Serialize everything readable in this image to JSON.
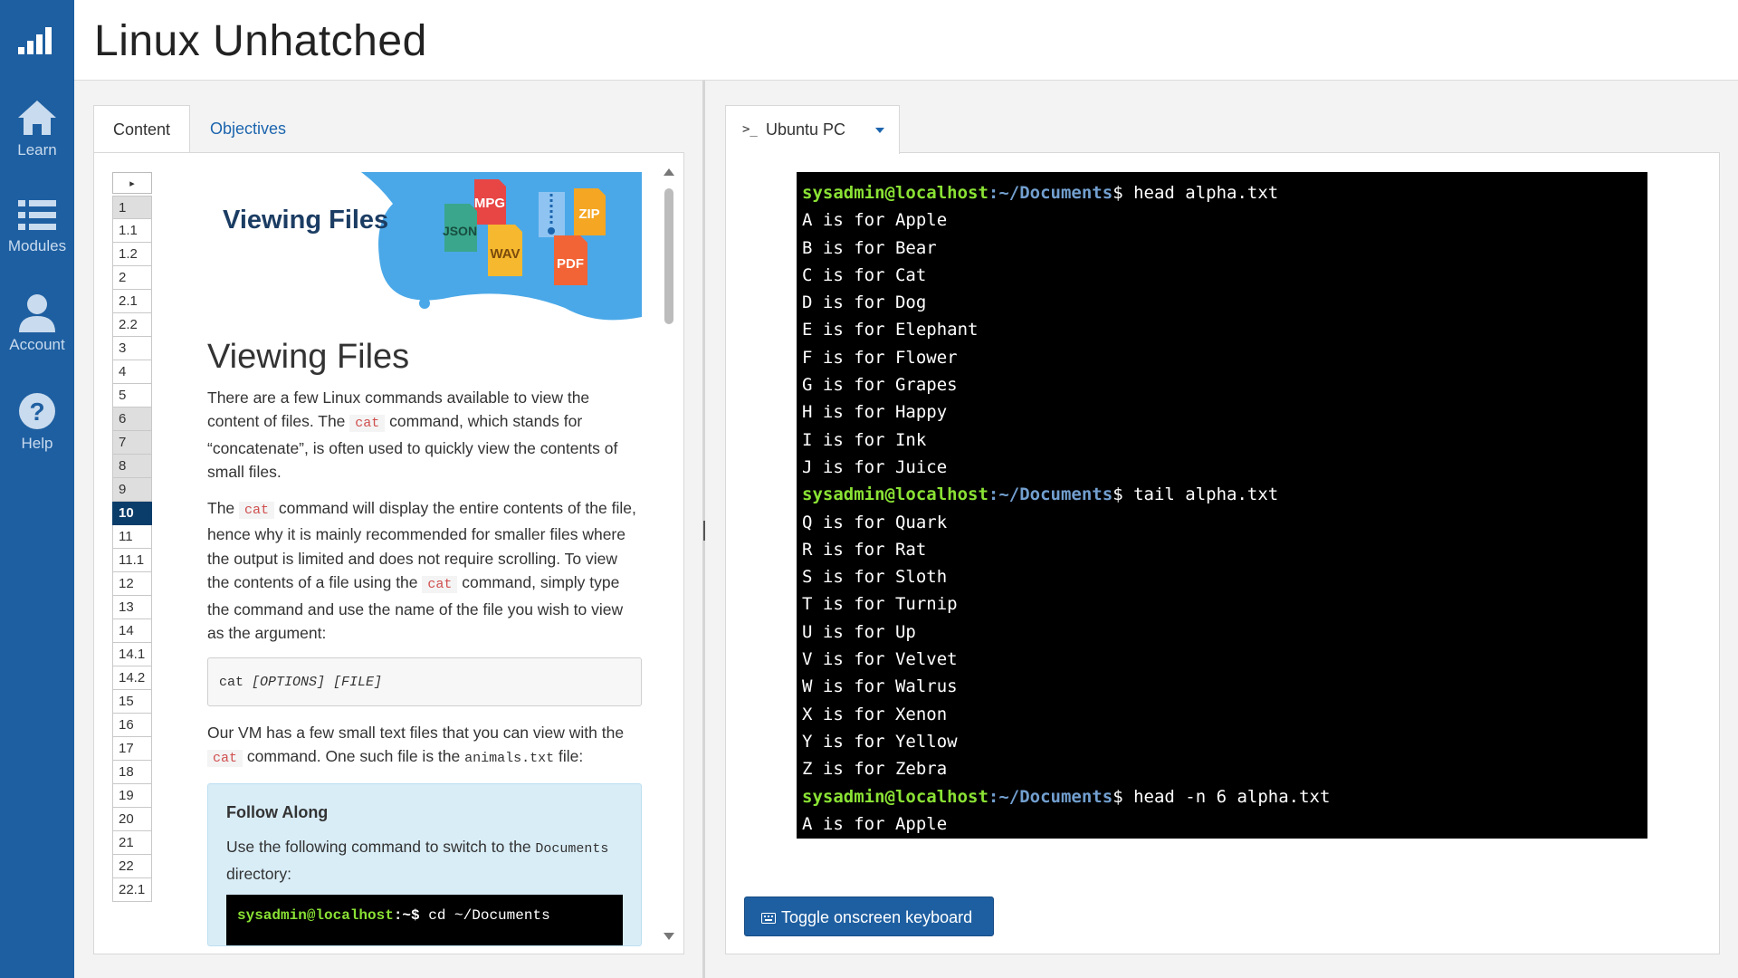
{
  "app": {
    "title": "Linux Unhatched"
  },
  "nav": [
    {
      "label": "Learn",
      "icon": "home-icon"
    },
    {
      "label": "Modules",
      "icon": "list-icon"
    },
    {
      "label": "Account",
      "icon": "user-icon"
    },
    {
      "label": "Help",
      "icon": "help-icon"
    }
  ],
  "tabs": {
    "content": "Content",
    "objectives": "Objectives"
  },
  "toc": {
    "toggle": "▸",
    "items": [
      "1",
      "1.1",
      "1.2",
      "2",
      "2.1",
      "2.2",
      "3",
      "4",
      "5",
      "6",
      "7",
      "8",
      "9",
      "10",
      "11",
      "11.1",
      "12",
      "13",
      "14",
      "14.1",
      "14.2",
      "15",
      "16",
      "17",
      "18",
      "19",
      "20",
      "21",
      "22",
      "22.1"
    ],
    "active": "10"
  },
  "article": {
    "banner_title": "Viewing Files",
    "banner_badges": [
      "MPG",
      "JSON",
      "WAV",
      "ZIP",
      "PDF"
    ],
    "heading": "Viewing Files",
    "p1_a": "There are a few Linux commands available to view the content of files. The ",
    "p1_code": "cat",
    "p1_b": " command, which stands for “concatenate”, is often used to quickly view the contents of small files.",
    "p2_a": "The ",
    "p2_code": "cat",
    "p2_b": " command will display the entire contents of the file, hence why it is mainly recommended for smaller files where the output is limited and does not require scrolling. To view the contents of a file using the ",
    "p2_code2": "cat",
    "p2_c": " command, simply type the command and use the name of the file you wish to view as the argument:",
    "syntax_cmd": "cat ",
    "syntax_args": "[OPTIONS] [FILE]",
    "p3_a": "Our VM has a few small text files that you can view with the ",
    "p3_code": "cat",
    "p3_b": " command. One such file is the ",
    "p3_file": "animals.txt",
    "p3_c": " file:",
    "follow_title": "Follow Along",
    "follow_text_a": "Use the following command to switch to the ",
    "follow_dir": "Documents",
    "follow_text_b": " directory:",
    "follow_prompt_user": "sysadmin@localhost",
    "follow_prompt_path": ":~$",
    "follow_cmd": " cd ~/Documents"
  },
  "terminal": {
    "tab_label": "Ubuntu PC",
    "prompt_user": "sysadmin@localhost",
    "prompt_path": ":~/Documents",
    "prompt_sign": "$ ",
    "commands": [
      "head alpha.txt",
      "tail alpha.txt",
      "head -n 6 alpha.txt"
    ],
    "head_output": [
      "A is for Apple",
      "B is for Bear",
      "C is for Cat",
      "D is for Dog",
      "E is for Elephant",
      "F is for Flower",
      "G is for Grapes",
      "H is for Happy",
      "I is for Ink",
      "J is for Juice"
    ],
    "tail_output": [
      "Q is for Quark",
      "R is for Rat",
      "S is for Sloth",
      "T is for Turnip",
      "U is for Up",
      "V is for Velvet",
      "W is for Walrus",
      "X is for Xenon",
      "Y is for Yellow",
      "Z is for Zebra"
    ],
    "head_n_output": [
      "A is for Apple"
    ]
  },
  "keyboard_button": {
    "label": "Toggle onscreen keyboard",
    "icon": "keyboard-icon"
  },
  "colors": {
    "sidebar": "#1e5fa1",
    "active_toc": "#0b3d6b",
    "prompt_user": "#8ae234",
    "prompt_path": "#729fcf",
    "inline_code": "#d04f4f"
  }
}
